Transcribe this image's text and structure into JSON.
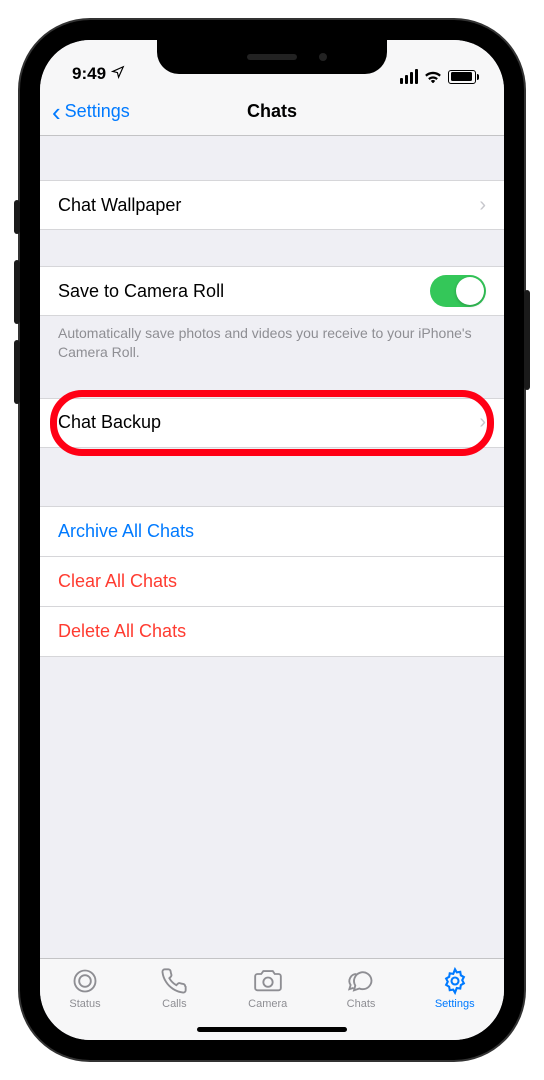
{
  "status": {
    "time": "9:49"
  },
  "nav": {
    "back": "Settings",
    "title": "Chats"
  },
  "rows": {
    "wallpaper": "Chat Wallpaper",
    "cameraRoll": "Save to Camera Roll",
    "cameraRollFooter": "Automatically save photos and videos you receive to your iPhone's Camera Roll.",
    "backup": "Chat Backup"
  },
  "actions": {
    "archive": "Archive All Chats",
    "clear": "Clear All Chats",
    "delete": "Delete All Chats"
  },
  "tabs": {
    "status": "Status",
    "calls": "Calls",
    "camera": "Camera",
    "chats": "Chats",
    "settings": "Settings"
  }
}
